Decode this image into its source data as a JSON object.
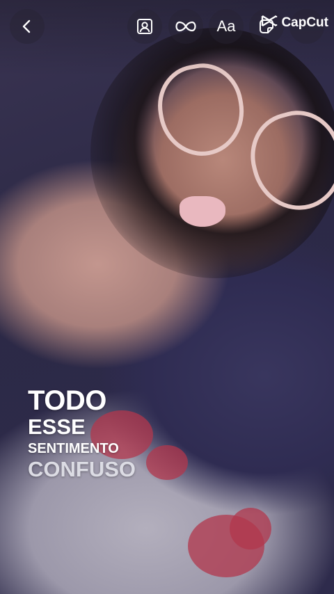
{
  "toolbar": {
    "back_icon": "chevron-left-icon",
    "person_icon": "portrait-frame-icon",
    "loop_icon": "infinity-icon",
    "text_label": "Aa",
    "sticker_icon": "sticker-icon",
    "more_icon": "more-icon"
  },
  "watermark": {
    "brand": "CapCut"
  },
  "caption": {
    "line1": "TODO",
    "line2": "ESSE",
    "line3": "SENTIMENTO",
    "line4": "CONFUSO"
  },
  "colors": {
    "caption_text": "#ffffff",
    "caption_fade": "#dcdce4",
    "button_bg": "rgba(40,36,52,0.45)"
  }
}
